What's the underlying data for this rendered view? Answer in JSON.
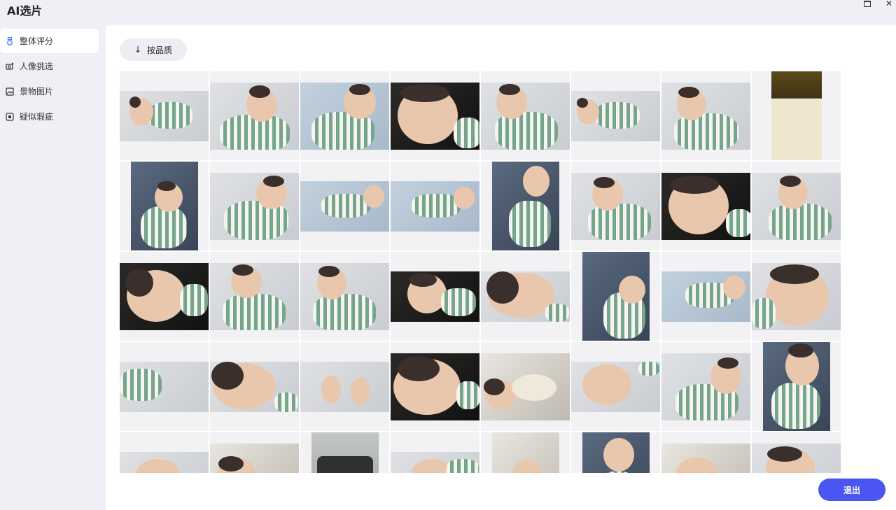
{
  "window": {
    "title": "AI选片",
    "maximize_icon": "maximize-icon",
    "close_icon": "close-icon",
    "close_glyph": "✕"
  },
  "sidebar": {
    "items": [
      {
        "label": "整体评分",
        "icon": "medal-icon",
        "active": true
      },
      {
        "label": "人像挑选",
        "icon": "portrait-camera-icon",
        "active": false
      },
      {
        "label": "景物图片",
        "icon": "landscape-image-icon",
        "active": false
      },
      {
        "label": "疑似瑕疵",
        "icon": "flaw-square-icon",
        "active": false
      }
    ]
  },
  "toolbar": {
    "sort_label": "按品质",
    "sort_icon": "arrow-down-icon",
    "sort_glyph": "↓"
  },
  "footer": {
    "exit_label": "退出"
  },
  "colors": {
    "accent": "#4a55f2",
    "sidebar_active_icon": "#4a7bf2",
    "background": "#eef0f5",
    "panel": "#ffffff"
  }
}
